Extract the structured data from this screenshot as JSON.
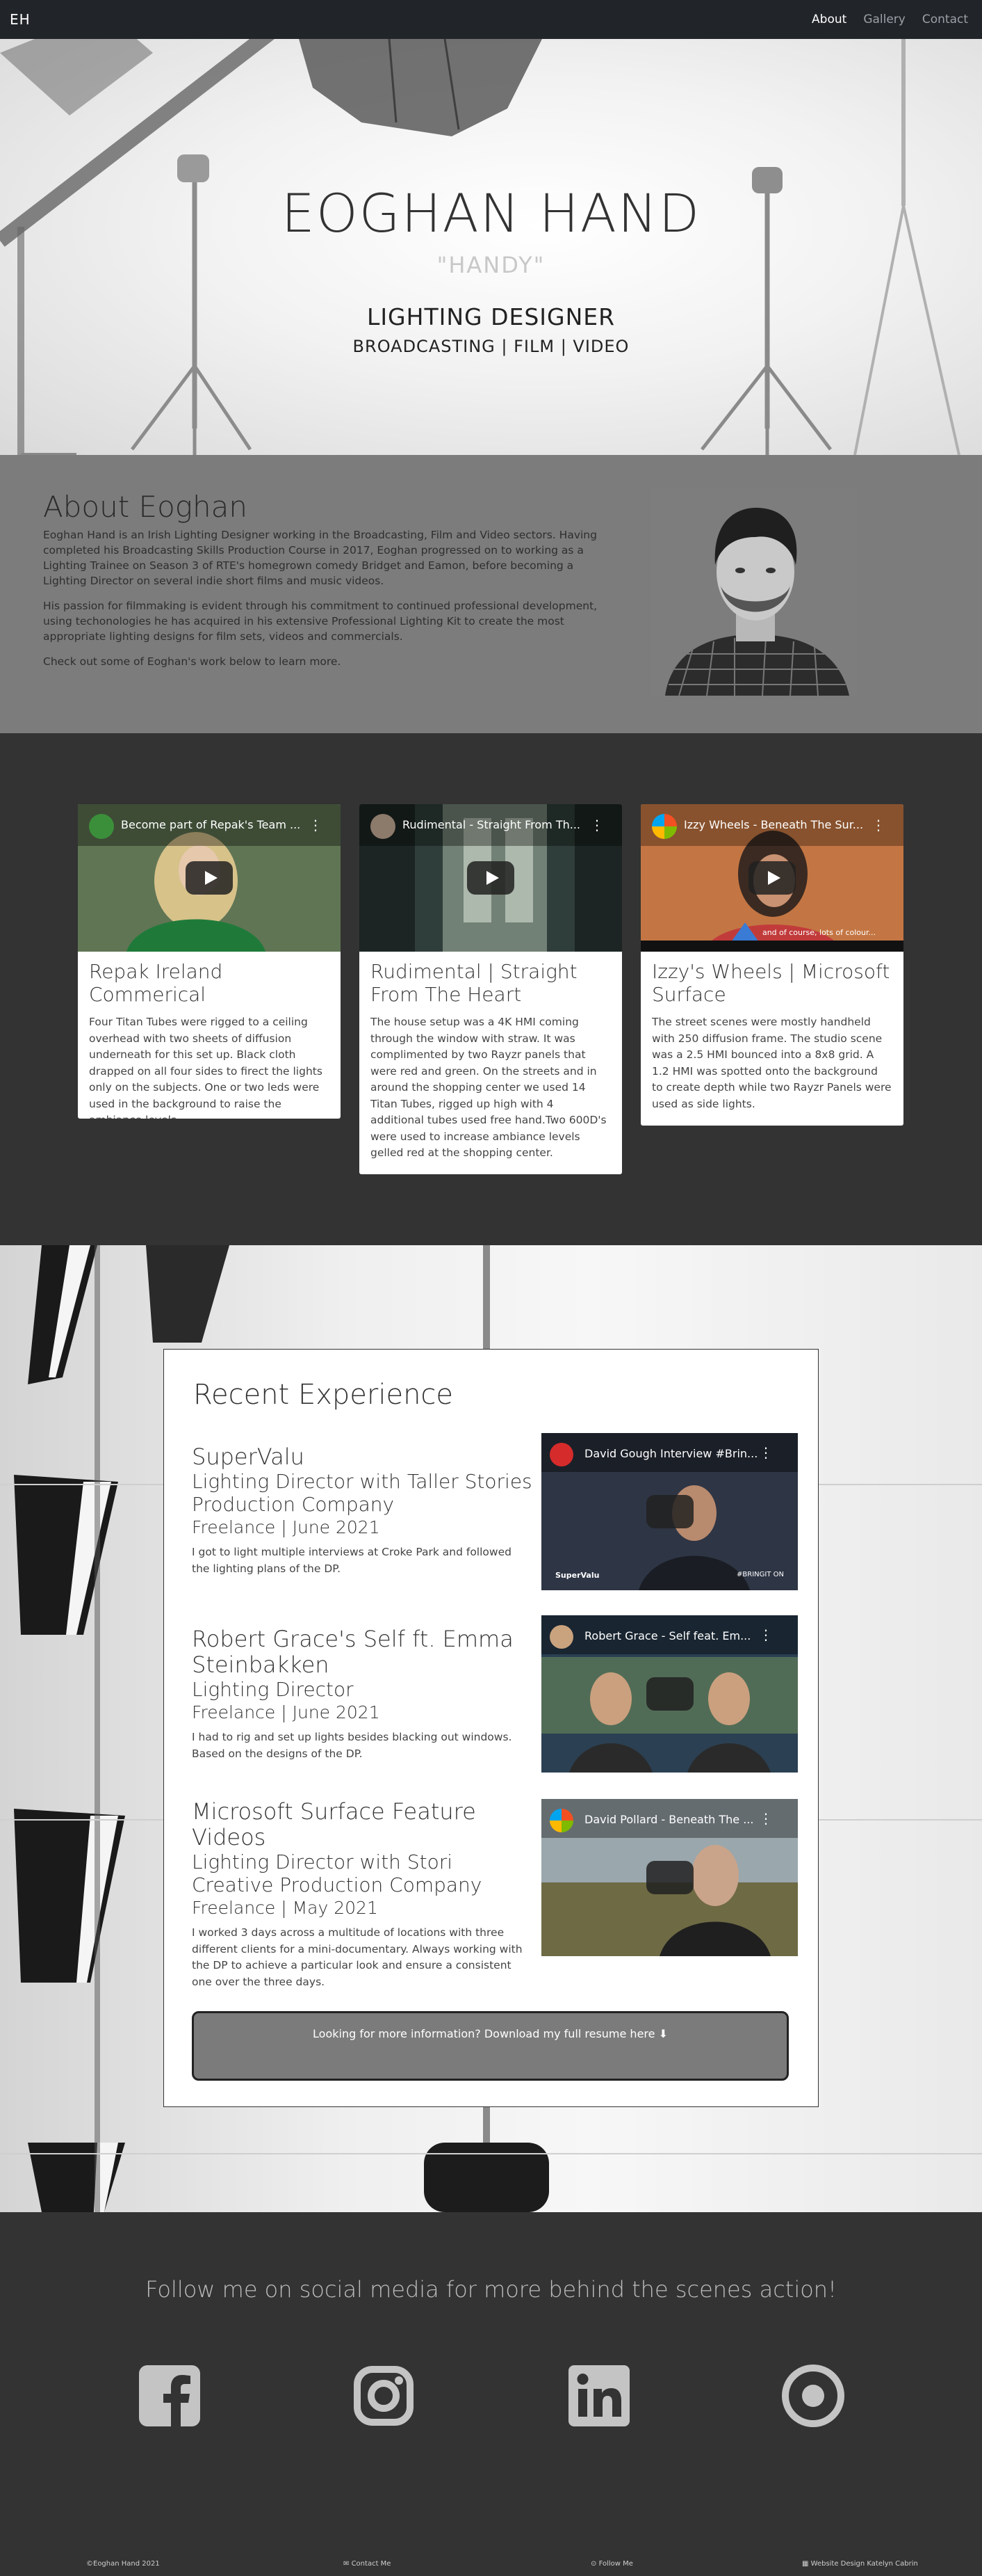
{
  "nav": {
    "brand": "EH",
    "links": [
      "About",
      "Gallery",
      "Contact"
    ]
  },
  "hero": {
    "name": "EOGHAN HAND",
    "nickname": "\"HANDY\"",
    "role": "LIGHTING DESIGNER",
    "subtitle": "BROADCASTING | FILM | VIDEO"
  },
  "about": {
    "title": "About Eoghan",
    "paragraphs": [
      "Eoghan Hand is an Irish Lighting Designer working in the Broadcasting, Film and Video sectors. Having completed his Broadcasting Skills Production Course in 2017, Eoghan progressed on to working as a Lighting Trainee on Season 3 of RTE's homegrown comedy Bridget and Eamon, before becoming a Lighting Director on several indie short films and music videos.",
      "His passion for filmmaking is evident through his commitment to continued professional development, using techonologies he has acquired in his extensive Professional Lighting Kit to create the most appropriate lighting designs for film sets, videos and commercials.",
      "Check out some of Eoghan's work below to learn more."
    ]
  },
  "projects": [
    {
      "video_title": "Become part of Repak's Team ...",
      "title": "Repak Ireland Commerical",
      "text": "Four Titan Tubes were rigged to a ceiling overhead with two sheets of diffusion underneath for this set up. Black cloth drapped on all four sides to firect the lights only on the subjects. One or two leds were used in the background to raise the ambiance levels."
    },
    {
      "video_title": "Rudimental - Straight From Th...",
      "title": "Rudimental | Straight From The Heart",
      "text": "The house setup was a 4K HMI coming through the window with straw. It was complimented by two Rayzr panels that were red and green. On the streets and in around the shopping center we used 14 Titan Tubes, rigged up high with 4 additional tubes used free hand.Two 600D's were used to increase ambiance levels gelled red at the shopping center."
    },
    {
      "video_title": "Izzy Wheels - Beneath The Sur...",
      "caption": "and of course, lots of colour...",
      "title": "Izzy's Wheels | Microsoft Surface",
      "text": "The street scenes were mostly handheld with 250 diffusion frame. The studio scene was a 2.5 HMI bounced into a 8x8 grid. A 1.2 HMI was spotted onto the background to create depth while two Rayzr Panels were used as side lights."
    }
  ],
  "experience": {
    "heading": "Recent Experience",
    "jobs": [
      {
        "title": "SuperValu",
        "role": "Lighting Director with Taller Stories Production Company",
        "meta": "Freelance | June 2021",
        "desc": "I got to light multiple interviews at Croke Park and followed the lighting plans of the DP.",
        "video_title": "David Gough Interview #Brin...",
        "video_badge": "SuperValu",
        "video_tag": "#BRINGIT ON"
      },
      {
        "title": "Robert Grace's Self ft. Emma Steinbakken",
        "role": "Lighting Director",
        "meta": "Freelance | June 2021",
        "desc": "I had to rig and set up lights besides blacking out windows. Based on the designs of the DP.",
        "video_title": "Robert Grace - Self feat. Em..."
      },
      {
        "title": "Microsoft Surface Feature Videos",
        "role": "Lighting Director with Stori Creative Production Company",
        "meta": "Freelance | May 2021",
        "desc": "I worked 3 days across a multitude of locations with three different clients for a mini-documentary. Always working with the DP to achieve a particular look and ensure a consistent one over the three days.",
        "video_title": "David Pollard - Beneath The ..."
      }
    ],
    "resume_text": "Looking for more information? Download my full resume here"
  },
  "social": {
    "title": "Follow me on social media for more behind the scenes action!",
    "icons": [
      "facebook-icon",
      "instagram-icon",
      "linkedin-icon",
      "target-icon"
    ]
  },
  "footer": {
    "copyright": "©Eoghan Hand 2021",
    "contact": "Contact Me",
    "follow": "Follow Me",
    "credit": "Website Design Katelyn Cabrin"
  }
}
